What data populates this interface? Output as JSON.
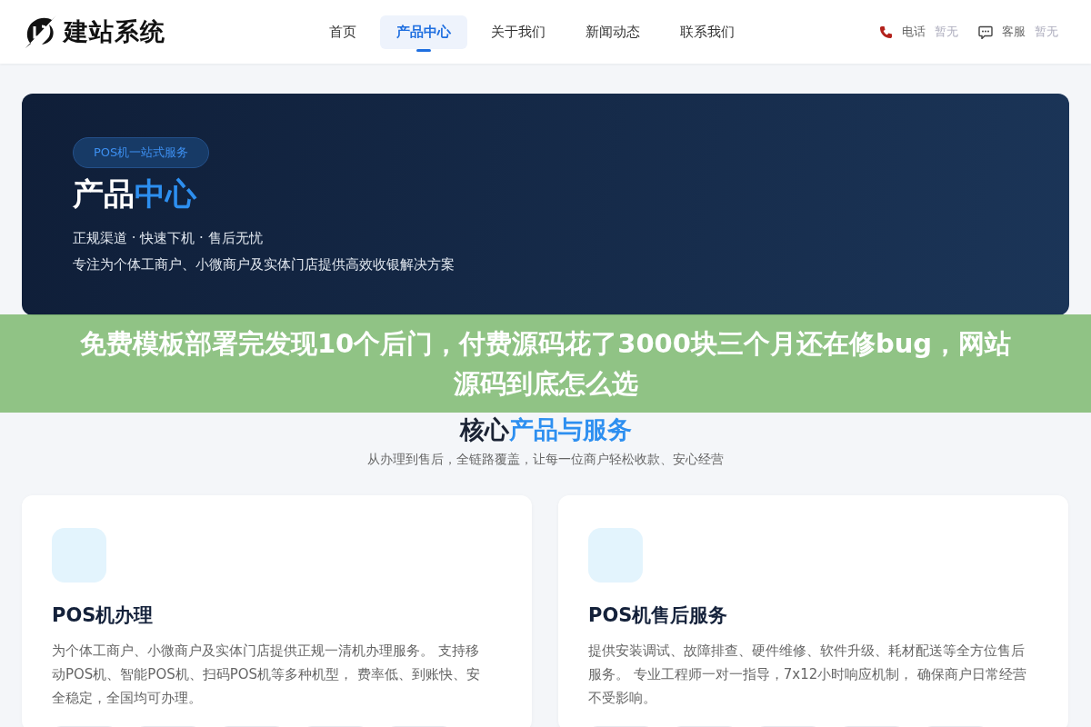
{
  "header": {
    "logo_text": "建站系统",
    "nav": [
      {
        "label": "首页",
        "selected": false
      },
      {
        "label": "产品中心",
        "selected": true
      },
      {
        "label": "关于我们",
        "selected": false
      },
      {
        "label": "新闻动态",
        "selected": false
      },
      {
        "label": "联系我们",
        "selected": false
      }
    ],
    "contacts": [
      {
        "kind": "phone",
        "label": "电话",
        "value": "暂无"
      },
      {
        "kind": "chat",
        "label": "客服",
        "value": "暂无"
      }
    ]
  },
  "hero": {
    "badge": "POS机一站式服务",
    "title_plain": "产品",
    "title_accent": "中心",
    "tagline": "正规渠道 · 快速下机 · 售后无忧",
    "description": "专注为个体工商户、小微商户及实体门店提供高效收银解决方案"
  },
  "section": {
    "title_plain": "核心",
    "title_accent": "产品与服务",
    "subtitle": "从办理到售后，全链路覆盖，让每一位商户轻松收款、安心经营"
  },
  "cards": [
    {
      "title": "POS机办理",
      "description": "为个体工商户、小微商户及实体门店提供正规一清机办理服务。 支持移动POS机、智能POS机、扫码POS机等多种机型， 费率低、到账快、安全稳定，全国均可办理。"
    },
    {
      "title": "POS机售后服务",
      "description": "提供安装调试、故障排查、硬件维修、软件升级、耗材配送等全方位售后服务。 专业工程师一对一指导，7x12小时响应机制， 确保商户日常经营不受影响。"
    }
  ],
  "overlay_banner": {
    "text": "免费模板部署完发现10个后门，付费源码花了3000块三个月还在修bug，网站源码到底怎么选"
  }
}
